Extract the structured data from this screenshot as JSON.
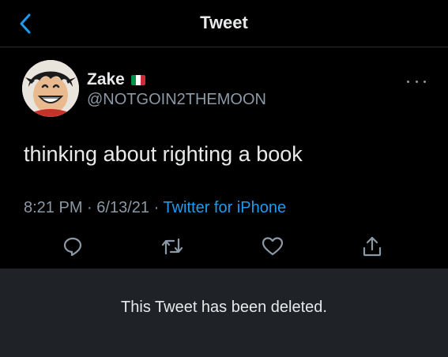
{
  "header": {
    "title": "Tweet",
    "back_icon": "chevron-left-icon"
  },
  "tweet": {
    "author": {
      "display_name": "Zake",
      "handle": "@NOTGOIN2THEMOON",
      "flag": "italy-flag-icon"
    },
    "text": "thinking about righting a book",
    "time": "8:21 PM",
    "separator": "·",
    "date": "6/13/21",
    "source": "Twitter for iPhone",
    "actions": [
      "reply-icon",
      "retweet-icon",
      "like-icon",
      "share-icon"
    ]
  },
  "deleted_notice": "This Tweet has been deleted.",
  "colors": {
    "background": "#000000",
    "text": "#e7e9ea",
    "secondary_text": "#8b98a5",
    "accent": "#1d9bf0",
    "banner": "#1f2327"
  }
}
